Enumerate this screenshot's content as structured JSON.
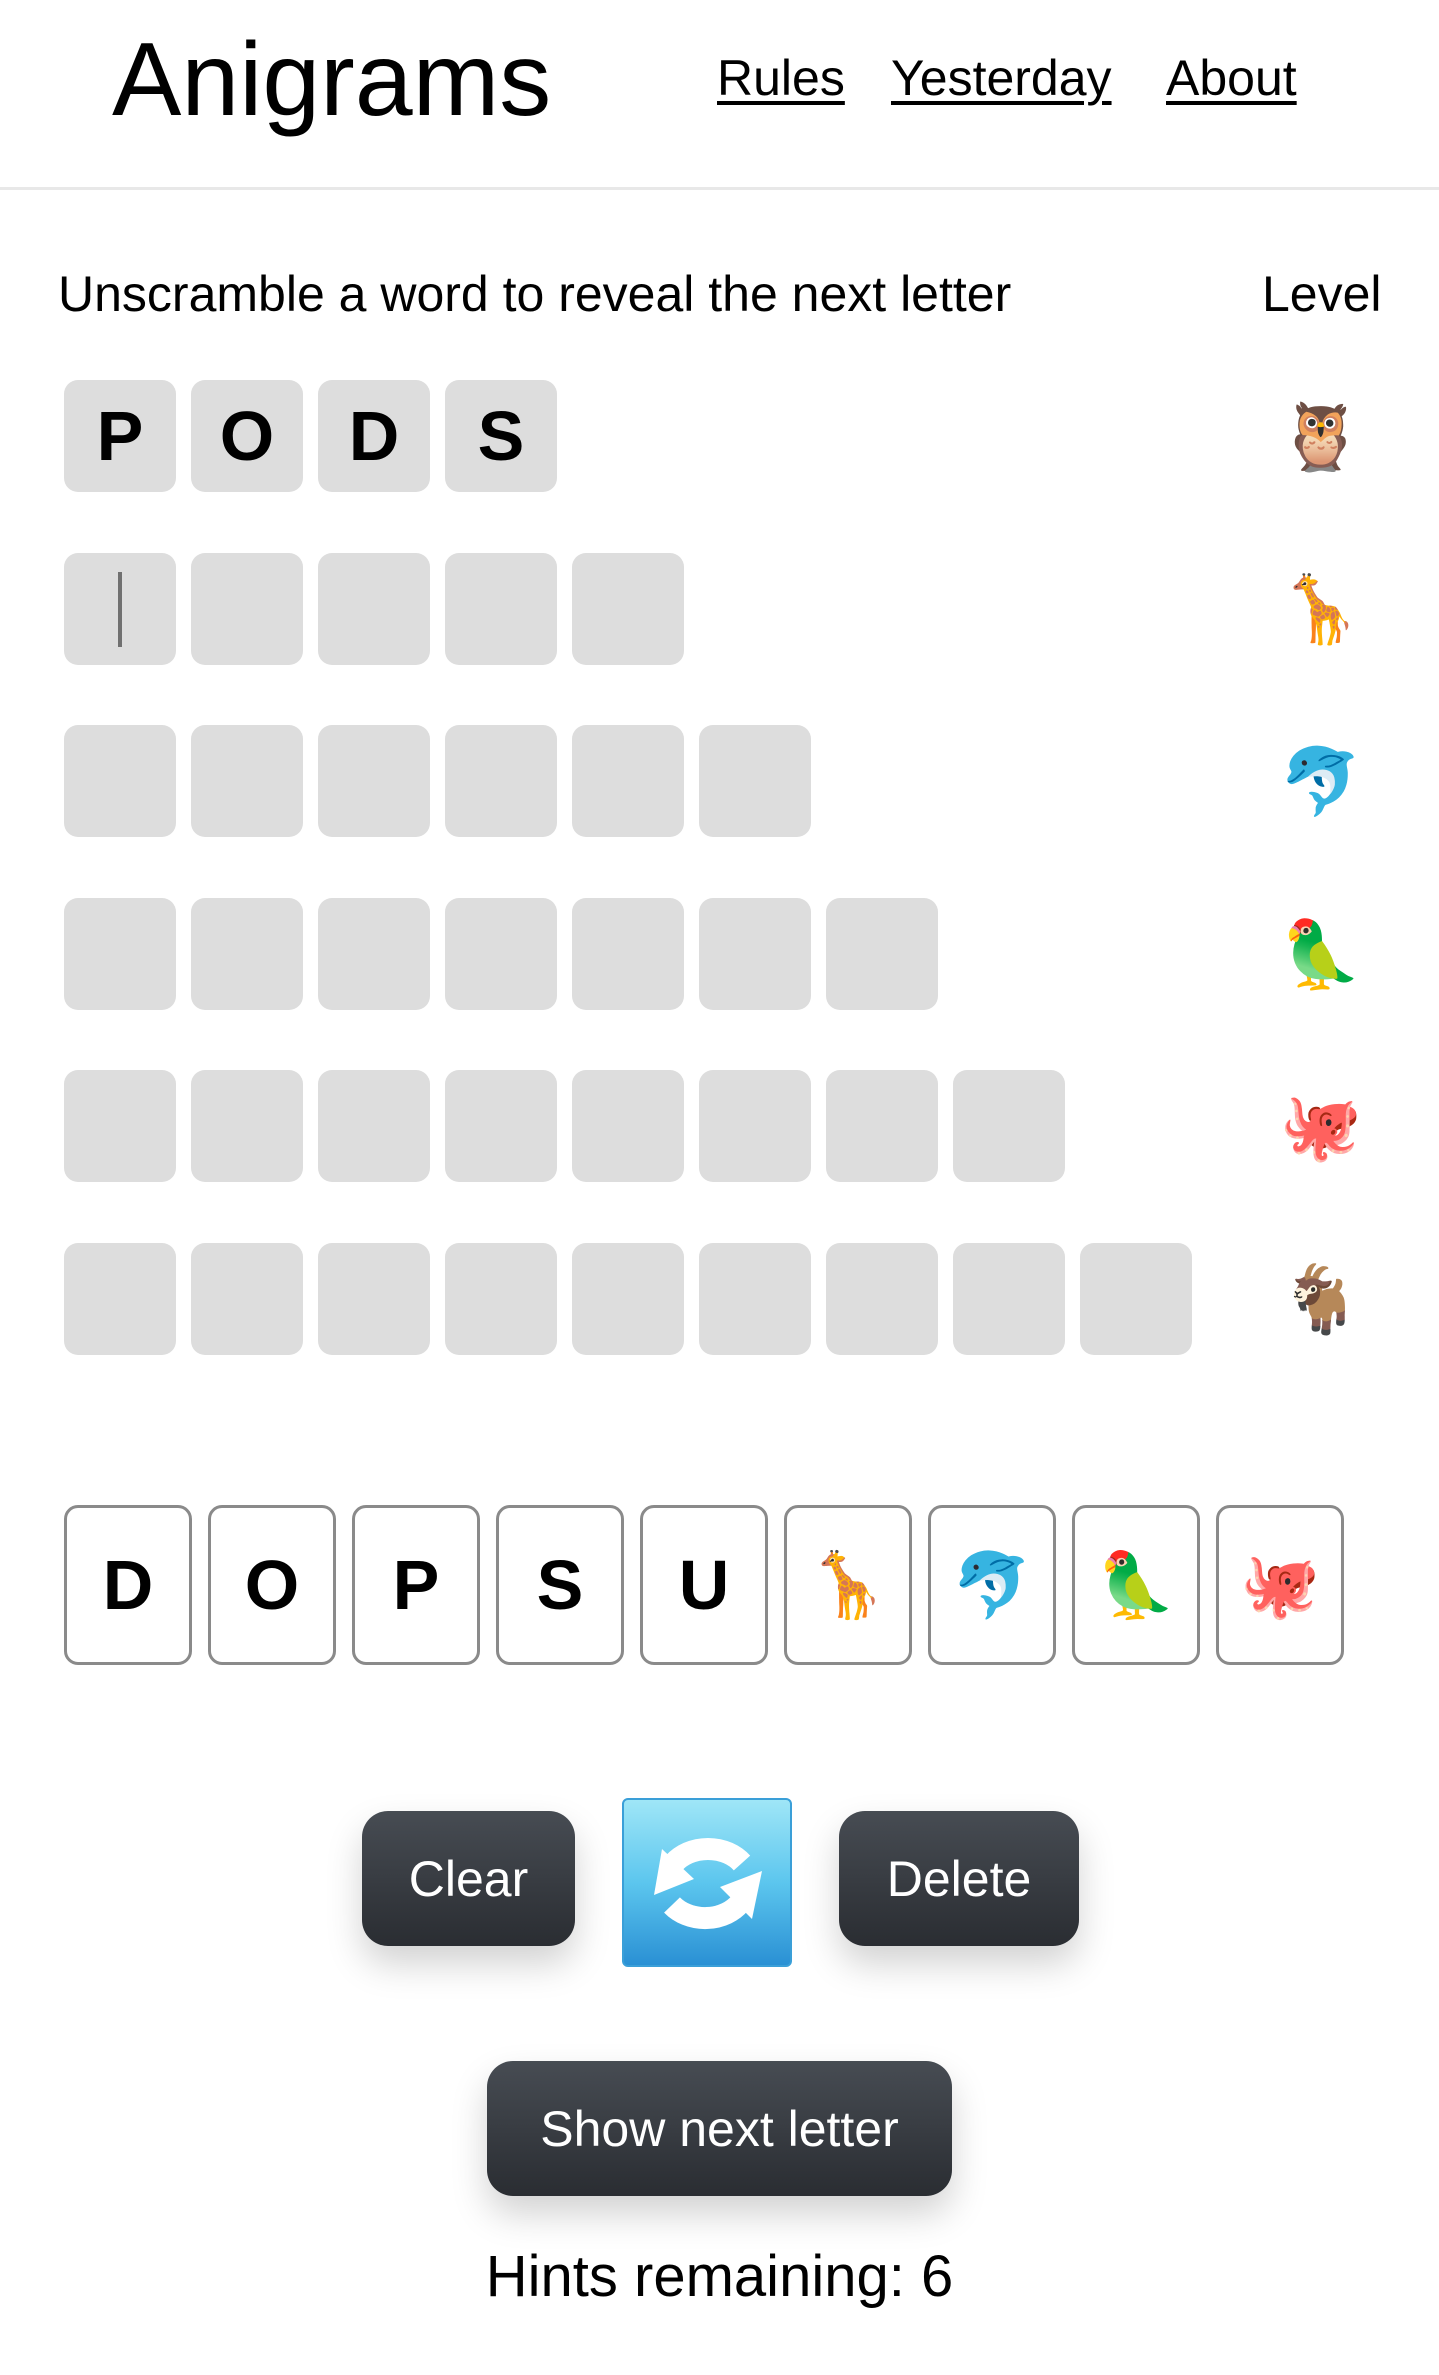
{
  "header": {
    "title": "Anigrams",
    "nav": [
      {
        "label": "Rules"
      },
      {
        "label": "Yesterday"
      },
      {
        "label": "About"
      }
    ]
  },
  "instructions": "Unscramble a word to reveal the next letter",
  "level_label": "Level",
  "rows": [
    {
      "level_icon": "🦉",
      "icon_name": "owl",
      "letters": [
        "P",
        "O",
        "D",
        "S"
      ],
      "solved": true
    },
    {
      "level_icon": "🦒",
      "icon_name": "giraffe",
      "letters": [
        "",
        "",
        "",
        "",
        ""
      ],
      "active": true
    },
    {
      "level_icon": "🐬",
      "icon_name": "dolphin",
      "letters": [
        "",
        "",
        "",
        "",
        "",
        ""
      ]
    },
    {
      "level_icon": "🦜",
      "icon_name": "parrot",
      "letters": [
        "",
        "",
        "",
        "",
        "",
        "",
        ""
      ]
    },
    {
      "level_icon": "🐙",
      "icon_name": "octopus",
      "letters": [
        "",
        "",
        "",
        "",
        "",
        "",
        "",
        ""
      ]
    },
    {
      "level_icon": "🐐",
      "icon_name": "goat",
      "letters": [
        "",
        "",
        "",
        "",
        "",
        "",
        "",
        "",
        ""
      ]
    }
  ],
  "letter_bank": [
    {
      "value": "D",
      "type": "letter"
    },
    {
      "value": "O",
      "type": "letter"
    },
    {
      "value": "P",
      "type": "letter"
    },
    {
      "value": "S",
      "type": "letter"
    },
    {
      "value": "U",
      "type": "letter"
    },
    {
      "value": "🦒",
      "type": "emoji",
      "name": "giraffe"
    },
    {
      "value": "🐬",
      "type": "emoji",
      "name": "dolphin"
    },
    {
      "value": "🦜",
      "type": "emoji",
      "name": "parrot"
    },
    {
      "value": "🐙",
      "type": "emoji",
      "name": "octopus"
    }
  ],
  "controls": {
    "clear_label": "Clear",
    "shuffle_icon": "shuffle-icon",
    "delete_label": "Delete",
    "hint_label": "Show next letter"
  },
  "hints": {
    "text": "Hints remaining: 6",
    "remaining": 6
  },
  "colors": {
    "tile_bg": "#dddddd",
    "button_dark": "#2a2d32",
    "shuffle_blue": "#5cc6ee",
    "key_border": "#8a8a8a"
  }
}
